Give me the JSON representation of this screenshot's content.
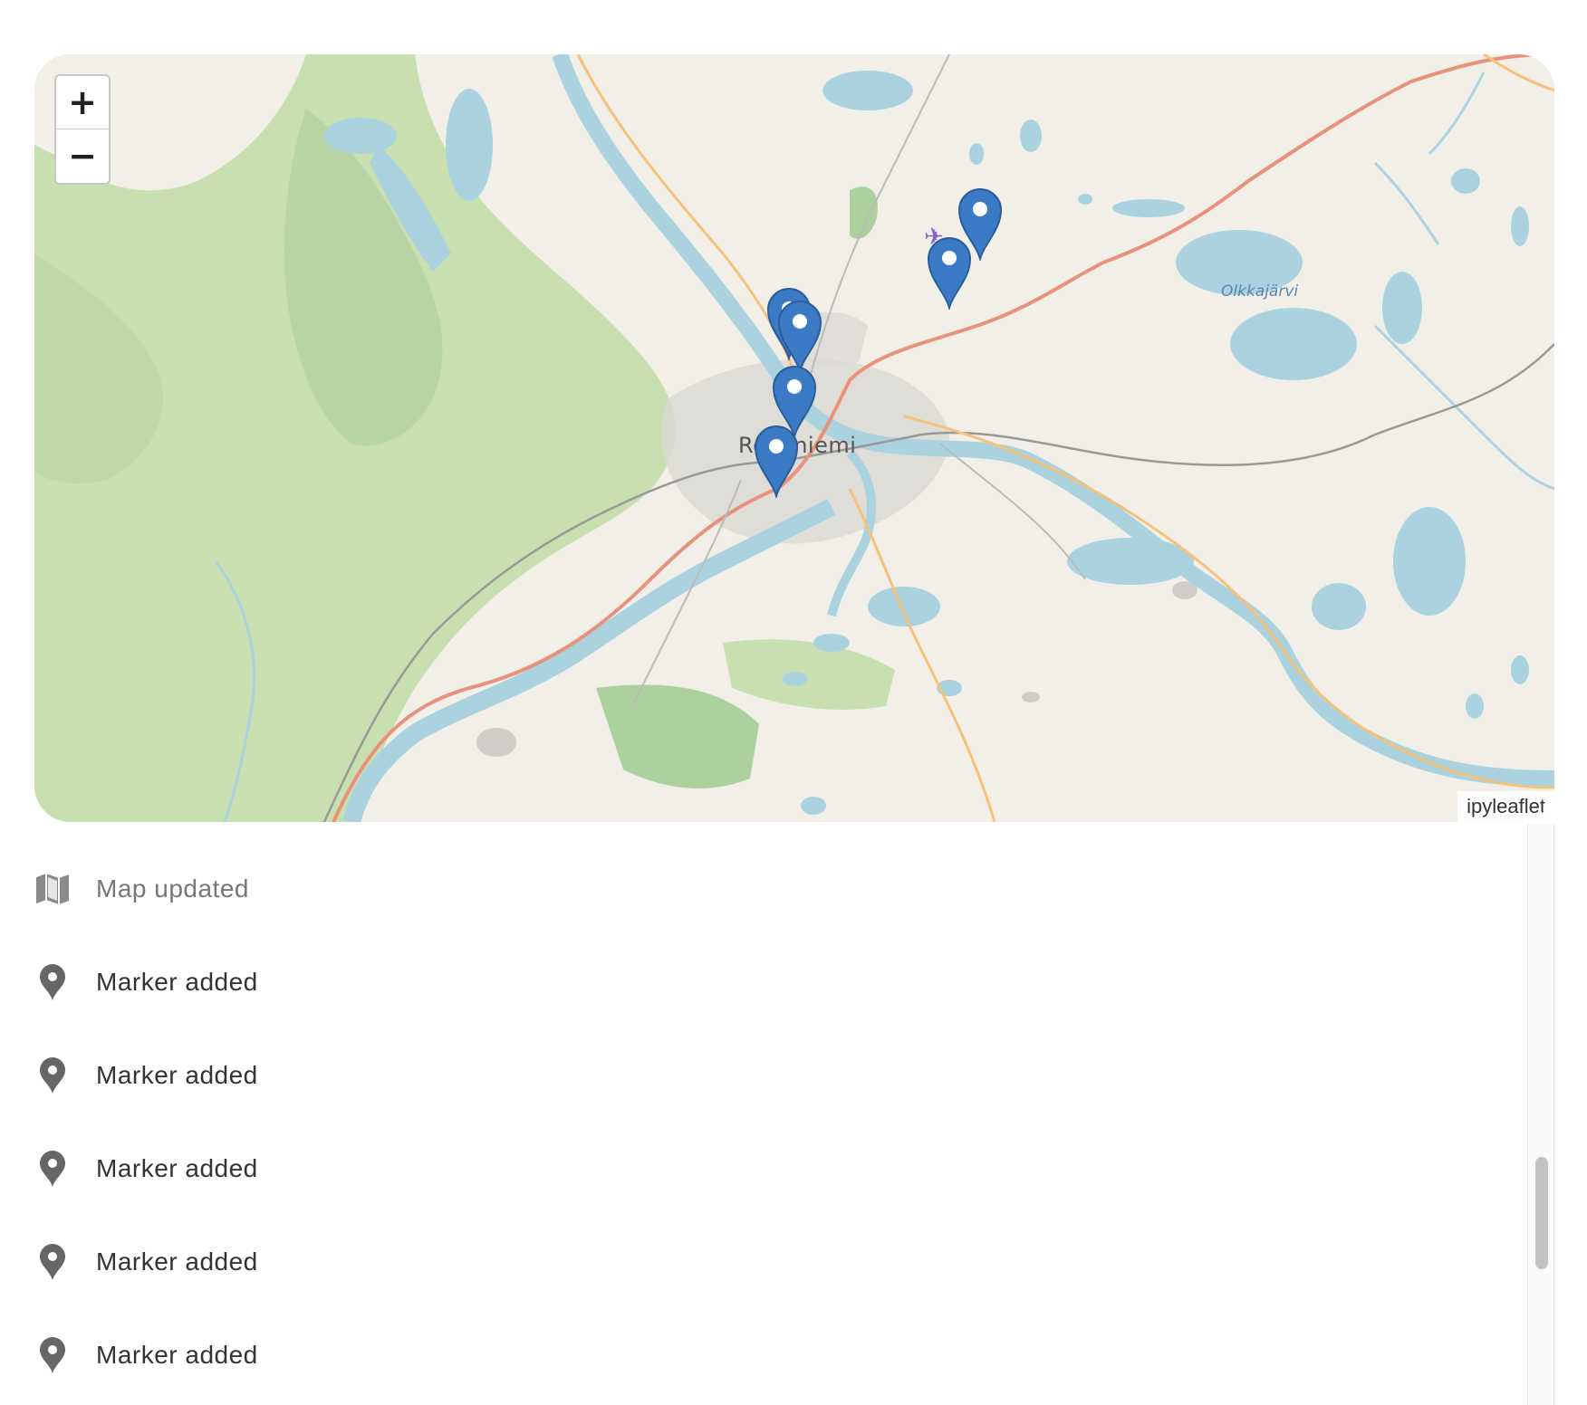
{
  "map": {
    "zoom_in_label": "+",
    "zoom_out_label": "−",
    "attribution": "ipyleaflet",
    "city_label": "Rovaniemi",
    "lake_label": "Olkkajärvi",
    "marker_color": "#3b7bc6",
    "marker_count": 6
  },
  "log": {
    "items": [
      {
        "icon": "map-icon",
        "text": "Map updated"
      },
      {
        "icon": "map-marker-icon",
        "text": "Marker added"
      },
      {
        "icon": "map-marker-icon",
        "text": "Marker added"
      },
      {
        "icon": "map-marker-icon",
        "text": "Marker added"
      },
      {
        "icon": "map-marker-icon",
        "text": "Marker added"
      },
      {
        "icon": "map-marker-icon",
        "text": "Marker added"
      }
    ]
  }
}
